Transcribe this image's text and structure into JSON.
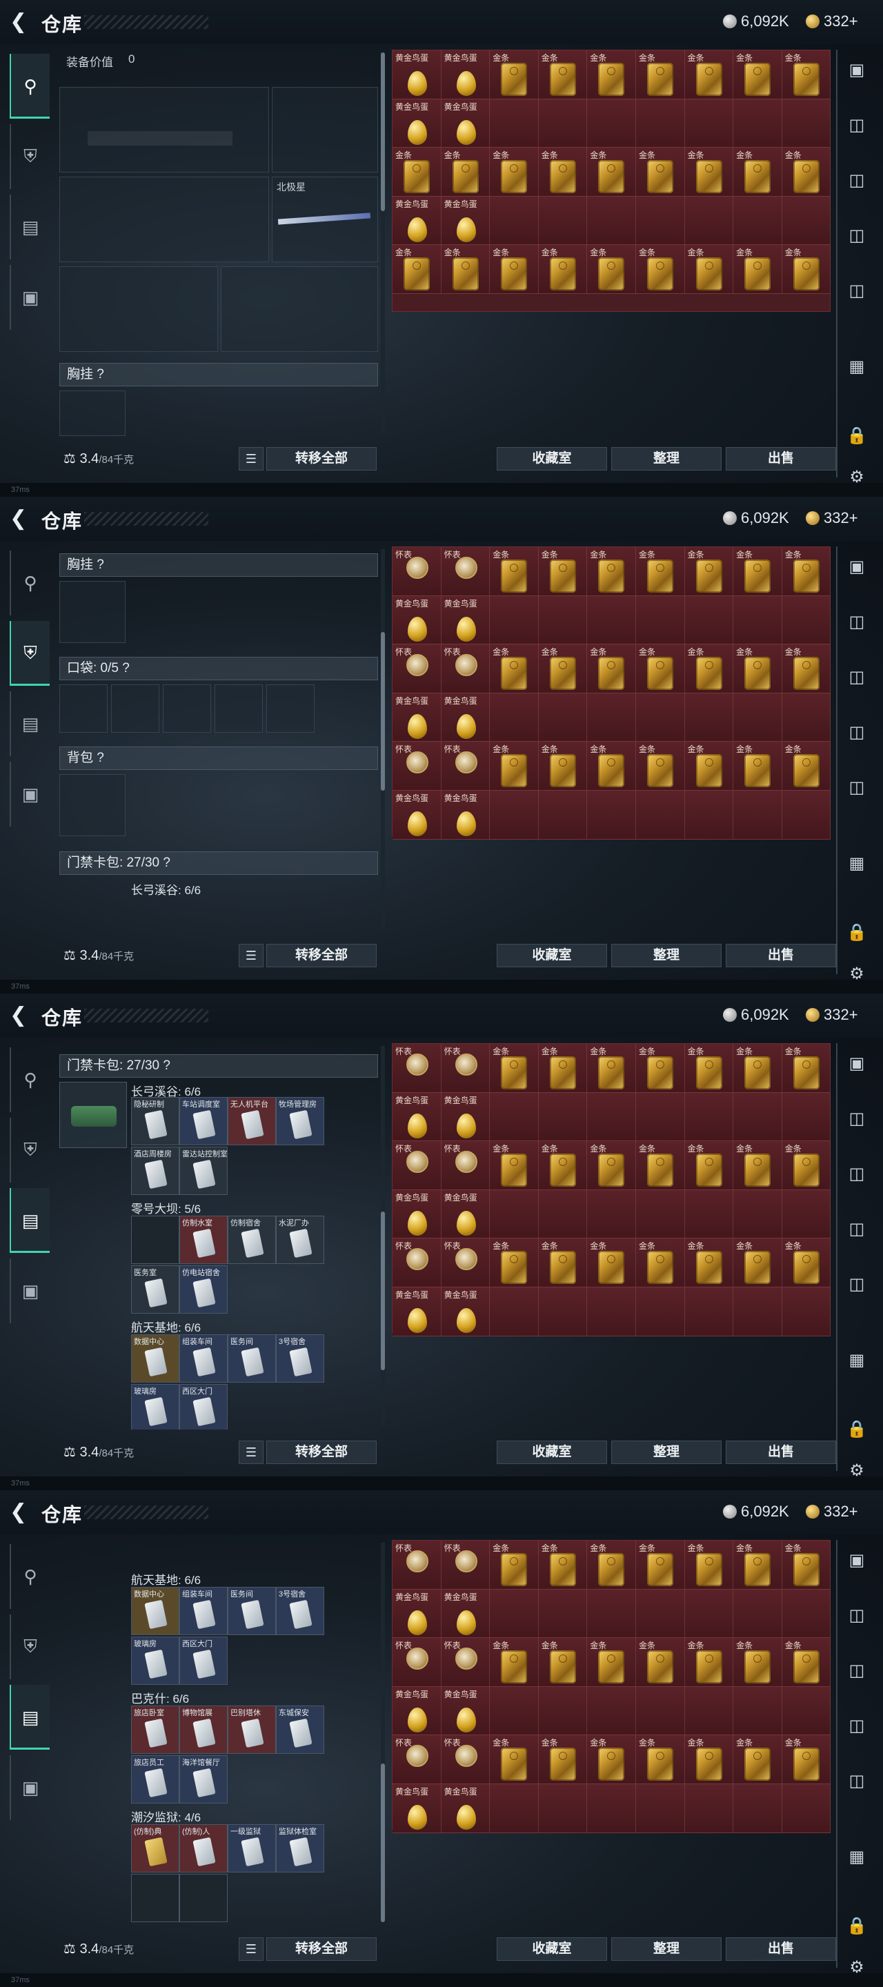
{
  "app": {
    "title": "仓库",
    "back_icon": "back-arrow-icon"
  },
  "currency": {
    "silver": "6,092K",
    "gold": "332+"
  },
  "status": {
    "ping": "37ms",
    "page": "8"
  },
  "nav_left": [
    "pistol-icon",
    "armor-icon",
    "clipboard-icon",
    "briefcase-icon"
  ],
  "equipment": {
    "value_label": "装备价值",
    "value": "0",
    "melee_name": "北极星",
    "chest_rig": "胸挂 ?",
    "pocket": "口袋: 0/5 ?",
    "backpack": "背包 ?",
    "keycard": "门禁卡包: 27/30 ?"
  },
  "keycards": {
    "group1": {
      "label": "长弓溪谷: 6/6",
      "cards": [
        "隐秘研制",
        "车站调度室",
        "无人机平台",
        "牧场管理房",
        "酒店周楼房",
        "雷达站控制室"
      ]
    },
    "group2": {
      "label": "零号大坝: 5/6",
      "cards": [
        "",
        "仿制水室",
        "仿制宿舍",
        "水泥厂办",
        "医务室",
        "仿电站宿舍"
      ]
    },
    "group3": {
      "label": "航天基地: 6/6",
      "cards": [
        "数据中心",
        "组装车间",
        "医务间",
        "3号宿舍",
        "玻璃房",
        "西区大门"
      ]
    },
    "group4": {
      "label": "巴克什: 6/6",
      "cards": [
        "旅店卧室",
        "博物馆展",
        "巴别塔休",
        "东城保安",
        "旅店员工",
        "海洋馆餐厅"
      ]
    },
    "group5": {
      "label": "潮汐监狱: 4/6",
      "cards": [
        "(仿制)典",
        "(仿制)人",
        "一级监狱",
        "监狱体检室"
      ]
    }
  },
  "bottom": {
    "weight": "3.4",
    "weight_max": "/84千克",
    "transfer_all": "转移全部",
    "collection": "收藏室",
    "sort": "整理",
    "sell": "出售"
  },
  "items": {
    "watch": "怀表",
    "egg": "黄金鸟蛋",
    "gold_bar": "金条"
  },
  "nav_right": [
    "helmet-icon",
    "card-icon",
    "card-icon",
    "card-icon",
    "card-icon",
    "card-stack-icon",
    "lock-icon",
    "gear-icon"
  ]
}
